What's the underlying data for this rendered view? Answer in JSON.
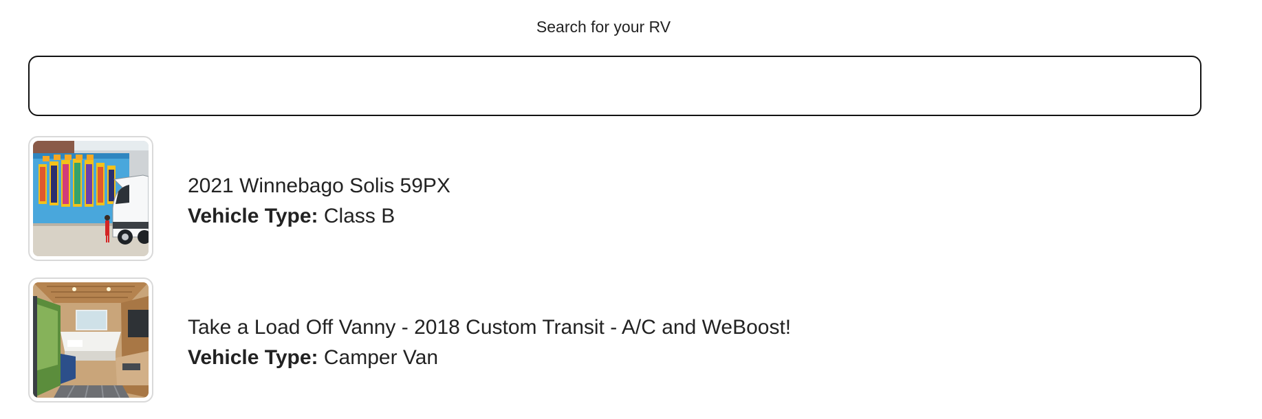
{
  "search": {
    "label": "Search for your RV",
    "value": "",
    "placeholder": ""
  },
  "results": [
    {
      "title": "2021 Winnebago Solis 59PX",
      "type_label": "Vehicle Type:",
      "type_value": "Class B",
      "image": "photo-van-in-front-of-chicago-mural"
    },
    {
      "title": "Take a Load Off Vanny - 2018 Custom Transit - A/C and WeBoost!",
      "type_label": "Vehicle Type:",
      "type_value": "Camper Van",
      "image": "photo-camper-van-interior"
    }
  ]
}
